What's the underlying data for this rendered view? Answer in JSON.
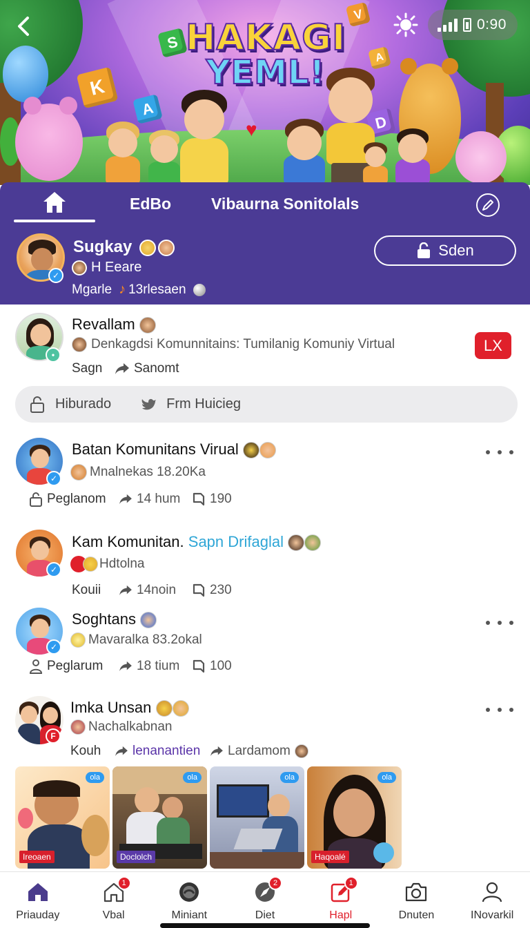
{
  "hero": {
    "title_line1": "HAKAGI",
    "title_line2": "YEML!",
    "cube_letters": [
      "S",
      "K",
      "A",
      "D",
      "V",
      "A"
    ]
  },
  "status_bar": {
    "time": "0:90"
  },
  "tabs": [
    {
      "label": "",
      "icon": "home-icon",
      "active": true
    },
    {
      "label": "EdBo"
    },
    {
      "label": "Vibaurna Sonitolals"
    }
  ],
  "profile": {
    "name": "Sugkay",
    "subtitle": "H Eeare",
    "meta_left": "Mgarle",
    "meta_right": "13rlesaen",
    "action_label": "Sden"
  },
  "featured_post": {
    "name": "Revallam",
    "description": "Denkagdsi Komunnitains: Tumilanig Komuniy Virtual",
    "action_left": "Sagn",
    "action_right": "Sanomt",
    "badge": "LX"
  },
  "filter_bar": {
    "left_label": "Hiburado",
    "right_label": "Frm Huicieg"
  },
  "posts": [
    {
      "name": "Batan Komunitans Virual",
      "highlight": "",
      "subtitle": "Mnalnekas 18.20Ka",
      "action_1": "Peglanom",
      "action_2": "14 hum",
      "action_3": "190"
    },
    {
      "name": "Kam Komunitan.",
      "highlight": "Sapn Drifaglal",
      "subtitle": "Hdtolna",
      "action_1": "Kouii",
      "action_2": "14noin",
      "action_3": "230"
    },
    {
      "name": "Soghtans",
      "highlight": "",
      "subtitle": "Mavaralka 83.2okal",
      "action_1": "Peglarum",
      "action_2": "18 tium",
      "action_3": "100"
    },
    {
      "name": "Imka Unsan",
      "highlight": "",
      "subtitle": "Nachalkabnan",
      "action_1": "Kouh",
      "action_2": "lenanantien",
      "action_3": "Lardamom"
    }
  ],
  "thumbnails": [
    {
      "tag": "Ireoaen",
      "badge": "ola",
      "tag_color": "#d8202c"
    },
    {
      "tag": "Doclolch",
      "badge": "ola",
      "tag_color": "#5a3aa8"
    },
    {
      "tag": "",
      "badge": "ola",
      "tag_color": ""
    },
    {
      "tag": "Haqoalé",
      "badge": "ola",
      "tag_color": "#d8202c"
    }
  ],
  "bottom_nav": [
    {
      "label": "Priauday",
      "icon": "home-filled-icon",
      "badge": ""
    },
    {
      "label": "Vbal",
      "icon": "house-outline-icon",
      "badge": "1"
    },
    {
      "label": "Miniant",
      "icon": "globe-icon",
      "badge": ""
    },
    {
      "label": "Diet",
      "icon": "compass-icon",
      "badge": "2"
    },
    {
      "label": "Hapl",
      "icon": "edit-square-icon",
      "badge": "1",
      "active": true
    },
    {
      "label": "Dnuten",
      "icon": "camera-icon",
      "badge": ""
    },
    {
      "label": "INovarkil",
      "icon": "person-icon",
      "badge": ""
    }
  ],
  "colors": {
    "header_purple": "#4b3b95",
    "accent_red": "#e0202b",
    "link_blue": "#2fa6d6",
    "link_purple": "#5a34a8"
  }
}
